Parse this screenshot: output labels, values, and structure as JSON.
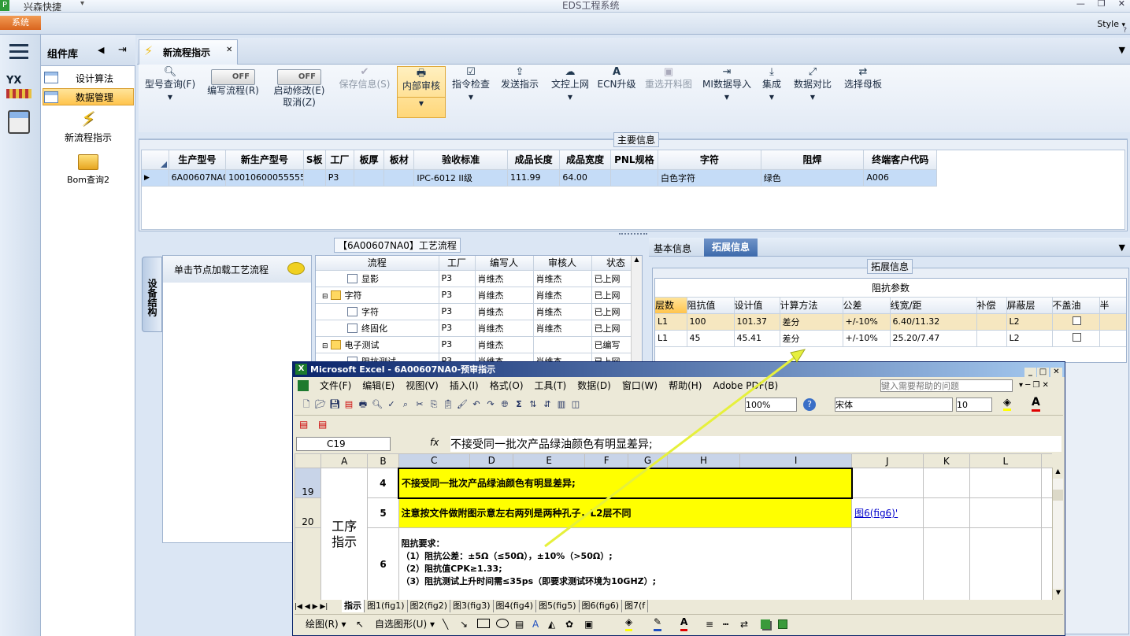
{
  "app": {
    "company": "兴森快捷",
    "title": "EDS工程系统",
    "style_menu": "Style"
  },
  "system_tab": "系统",
  "left_icons": [
    "menu-icon",
    "yx-factory-icon",
    "calculator-icon"
  ],
  "component_lib": {
    "title": "组件库",
    "items": [
      "设计算法",
      "数据管理"
    ],
    "selected": 1,
    "tools": [
      {
        "label": "新流程指示",
        "icon": "lightning-icon"
      },
      {
        "label": "Bom查询2",
        "icon": "folder-open-icon"
      }
    ]
  },
  "doc_tab": {
    "label": "新流程指示"
  },
  "ribbon": {
    "model_query": "型号查询(F)",
    "write_flow": "编写流程(R)",
    "write_flow_toggle": "OFF",
    "start_modify": "启动修改(E)",
    "start_modify_line2": "取消(Z)",
    "start_modify_toggle": "OFF",
    "save_info": "保存信息(S)",
    "internal_review": "内部审核",
    "order_check": "指令检查",
    "send_order": "发送指示",
    "doc_upload": "文控上网",
    "ecn_upgrade": "ECN升级",
    "reselect_chart": "重选开料图",
    "mi_import": "MI数据导入",
    "integrate": "集成",
    "data_compare": "数据对比",
    "select_mother": "选择母板"
  },
  "main_info": {
    "title": "主要信息",
    "headers": [
      "生产型号",
      "新生产型号",
      "S板",
      "工厂",
      "板厚",
      "板材",
      "验收标准",
      "成品长度",
      "成品宽度",
      "PNL规格",
      "字符",
      "阻焊",
      "终端客户代码"
    ],
    "row": [
      "6A00607NA0",
      "10010600055555",
      "",
      "P3",
      "",
      "",
      "IPC-6012 II级",
      "111.99",
      "64.00",
      "",
      "白色字符",
      "绿色",
      "A006"
    ]
  },
  "process": {
    "title": "【6A00607NA0】工艺流程",
    "side_tab": "设备结构",
    "load_hint": "单击节点加载工艺流程",
    "headers": [
      "流程",
      "工厂",
      "编写人",
      "审核人",
      "状态"
    ],
    "rows": [
      {
        "name": "显影",
        "indent": 2,
        "type": "doc",
        "factory": "P3",
        "writer": "肖维杰",
        "reviewer": "肖维杰",
        "status": "已上网"
      },
      {
        "name": "字符",
        "indent": 1,
        "type": "folder",
        "factory": "P3",
        "writer": "肖维杰",
        "reviewer": "肖维杰",
        "status": "已上网"
      },
      {
        "name": "字符",
        "indent": 2,
        "type": "doc",
        "factory": "P3",
        "writer": "肖维杰",
        "reviewer": "肖维杰",
        "status": "已上网"
      },
      {
        "name": "终固化",
        "indent": 2,
        "type": "doc",
        "factory": "P3",
        "writer": "肖维杰",
        "reviewer": "肖维杰",
        "status": "已上网"
      },
      {
        "name": "电子测试",
        "indent": 1,
        "type": "folder",
        "factory": "P3",
        "writer": "肖维杰",
        "reviewer": "",
        "status": "已编写"
      },
      {
        "name": "阻抗测试",
        "indent": 2,
        "type": "doc",
        "factory": "P3",
        "writer": "肖维杰",
        "reviewer": "肖维杰",
        "status": "已上网"
      }
    ]
  },
  "right_panel": {
    "tabs": [
      "基本信息",
      "拓展信息"
    ],
    "active": 1,
    "group_title": "拓展信息",
    "table_title": "阻抗参数",
    "headers": [
      "层数",
      "阻抗值",
      "设计值",
      "计算方法",
      "公差",
      "线宽/距",
      "补偿",
      "屏蔽层",
      "不盖油",
      "半"
    ],
    "rows": [
      [
        "L1",
        "100",
        "101.37",
        "差分",
        "+/-10%",
        "6.40/11.32",
        "",
        "L2",
        "",
        ""
      ],
      [
        "L1",
        "45",
        "45.41",
        "差分",
        "+/-10%",
        "25.20/7.47",
        "",
        "L2",
        "",
        ""
      ]
    ]
  },
  "excel": {
    "title": "Microsoft Excel - 6A00607NA0-预审指示",
    "menu": [
      "文件(F)",
      "编辑(E)",
      "视图(V)",
      "插入(I)",
      "格式(O)",
      "工具(T)",
      "数据(D)",
      "窗口(W)",
      "帮助(H)",
      "Adobe PDF(B)"
    ],
    "help_placeholder": "键入需要帮助的问题",
    "zoom": "100%",
    "font": "宋体",
    "font_size": "10",
    "cell_ref": "C19",
    "formula": "不接受同一批次产品绿油颜色有明显差异;",
    "cols": [
      "A",
      "B",
      "C",
      "D",
      "E",
      "F",
      "G",
      "H",
      "I",
      "J",
      "K",
      "L",
      "M"
    ],
    "rows": [
      {
        "num": "19",
        "step": "4",
        "text": "不接受同一批次产品绿油颜色有明显差异;",
        "link": ""
      },
      {
        "num": "20",
        "step": "5",
        "text": "注意按文件做附图示意左右两列是两种孔子，L2层不同",
        "link": "图6(fig6)'"
      },
      {
        "num": "",
        "step": "6",
        "text": "",
        "link": ""
      }
    ],
    "merged_label": "工序指示",
    "impedance_req": [
      "阻抗要求：",
      "（1）阻抗公差：±5Ω（≤50Ω），±10%（>50Ω）;",
      "（2）阻抗值CPK≥1.33;",
      "（3）阻抗测试上升时间需≤35ps（即要求测试环境为10GHZ）;"
    ],
    "sheets": [
      "指示",
      "图1(fig1)",
      "图2(fig2)",
      "图3(fig3)",
      "图4(fig4)",
      "图5(fig5)",
      "图6(fig6)",
      "图7(f"
    ],
    "draw_label": "绘图(R)",
    "autoshape_label": "自选图形(U)"
  },
  "colors": {
    "accent_orange": "#ffd77a",
    "selected_row": "#c5dcf7",
    "yellow": "#ffff00",
    "arrow": "#e6f03c"
  }
}
